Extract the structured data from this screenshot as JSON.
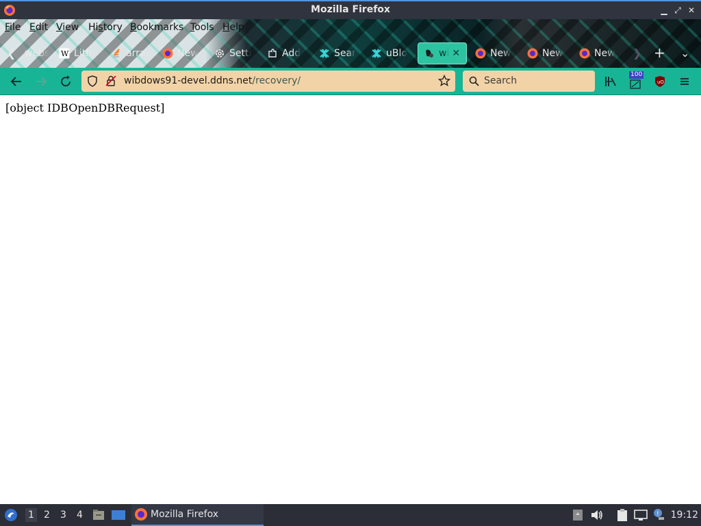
{
  "window": {
    "title": "Mozilla Firefox"
  },
  "menu": [
    "File",
    "Edit",
    "View",
    "History",
    "Bookmarks",
    "Tools",
    "Help"
  ],
  "menu_underline": [
    "F",
    "E",
    "V",
    "s",
    "B",
    "T",
    "H"
  ],
  "tabs": [
    {
      "label": "webs",
      "icon": "none"
    },
    {
      "label": "Lithu",
      "icon": "wikipedia-icon"
    },
    {
      "label": "array",
      "icon": "stackoverflow-icon"
    },
    {
      "label": "New",
      "icon": "firefox-icon"
    },
    {
      "label": "Setti",
      "icon": "gear-icon"
    },
    {
      "label": "Add",
      "icon": "puzzle-icon"
    },
    {
      "label": "Sear",
      "icon": "extension-icon"
    },
    {
      "label": "uBlo",
      "icon": "extension-icon"
    },
    {
      "label": "wi",
      "icon": "site-icon",
      "active": true
    },
    {
      "label": "New",
      "icon": "firefox-icon"
    },
    {
      "label": "New",
      "icon": "firefox-icon"
    },
    {
      "label": "New",
      "icon": "firefox-icon"
    }
  ],
  "navbar": {
    "url_host": "wibdows91-devel.ddns.net",
    "url_path": "/recovery/",
    "search_placeholder": "Search",
    "badge_count": "100"
  },
  "page": {
    "text": "[object IDBOpenDBRequest]"
  },
  "taskbar": {
    "workspaces": [
      "1",
      "2",
      "3",
      "4"
    ],
    "active_workspace": "1",
    "task_label": "Mozilla Firefox",
    "clock": "19:12"
  },
  "colors": {
    "accent": "#17b596",
    "urlbar_bg": "#f2d3a7",
    "active_tab": "#2ec3a0",
    "titlebar": "#2f343f",
    "taskbar": "#2b2e37"
  }
}
